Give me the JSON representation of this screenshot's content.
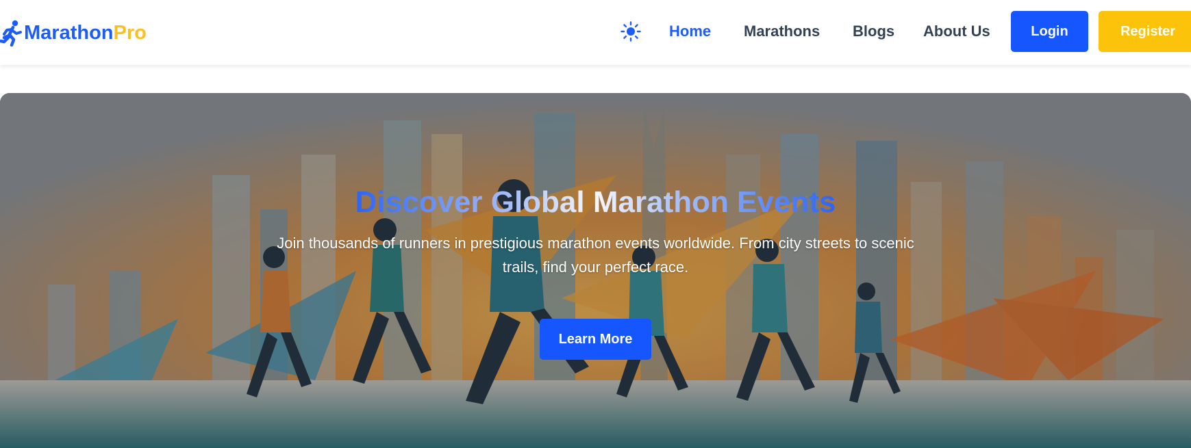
{
  "brand": {
    "name_part1": "Marathon",
    "name_part2": "Pro",
    "icon": "runner-icon",
    "color_primary": "#1d5cf5",
    "color_accent": "#fbbf24"
  },
  "nav": {
    "theme_icon": "sun-icon",
    "links": [
      {
        "label": "Home",
        "active": true
      },
      {
        "label": "Marathons",
        "active": false
      },
      {
        "label": "Blogs",
        "active": false
      },
      {
        "label": "About Us",
        "active": false
      }
    ],
    "login_label": "Login",
    "register_label": "Register"
  },
  "hero": {
    "title": "Discover Global Marathon Events",
    "subtitle": "Join thousands of runners in prestigious marathon events worldwide. From city streets to scenic trails, find your perfect race.",
    "cta_label": "Learn More",
    "image": "runners-city-illustration"
  },
  "colors": {
    "button_blue": "#1556ff",
    "button_yellow": "#fcc30b",
    "nav_text": "#334155"
  }
}
